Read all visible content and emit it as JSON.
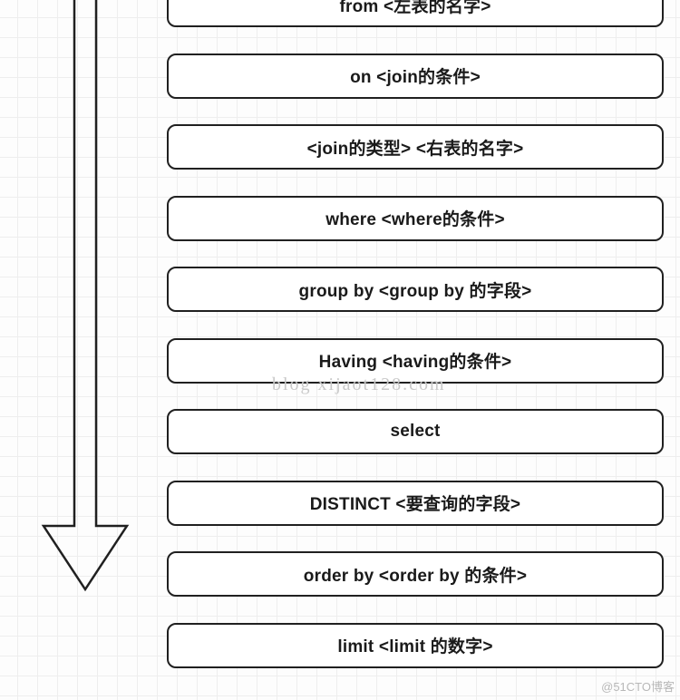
{
  "steps": [
    {
      "label": "from  <左表的名字>"
    },
    {
      "label": "on <join的条件>"
    },
    {
      "label": "<join的类型> <右表的名字>"
    },
    {
      "label": "where <where的条件>"
    },
    {
      "label": "group by <group by 的字段>"
    },
    {
      "label": "Having <having的条件>"
    },
    {
      "label": "select"
    },
    {
      "label": "DISTINCT <要查询的字段>"
    },
    {
      "label": "order by <order by 的条件>"
    },
    {
      "label": "limit <limit 的数字>"
    }
  ],
  "watermark_mid": "blog xijaot128.com",
  "watermark_corner": "@51CTO博客"
}
